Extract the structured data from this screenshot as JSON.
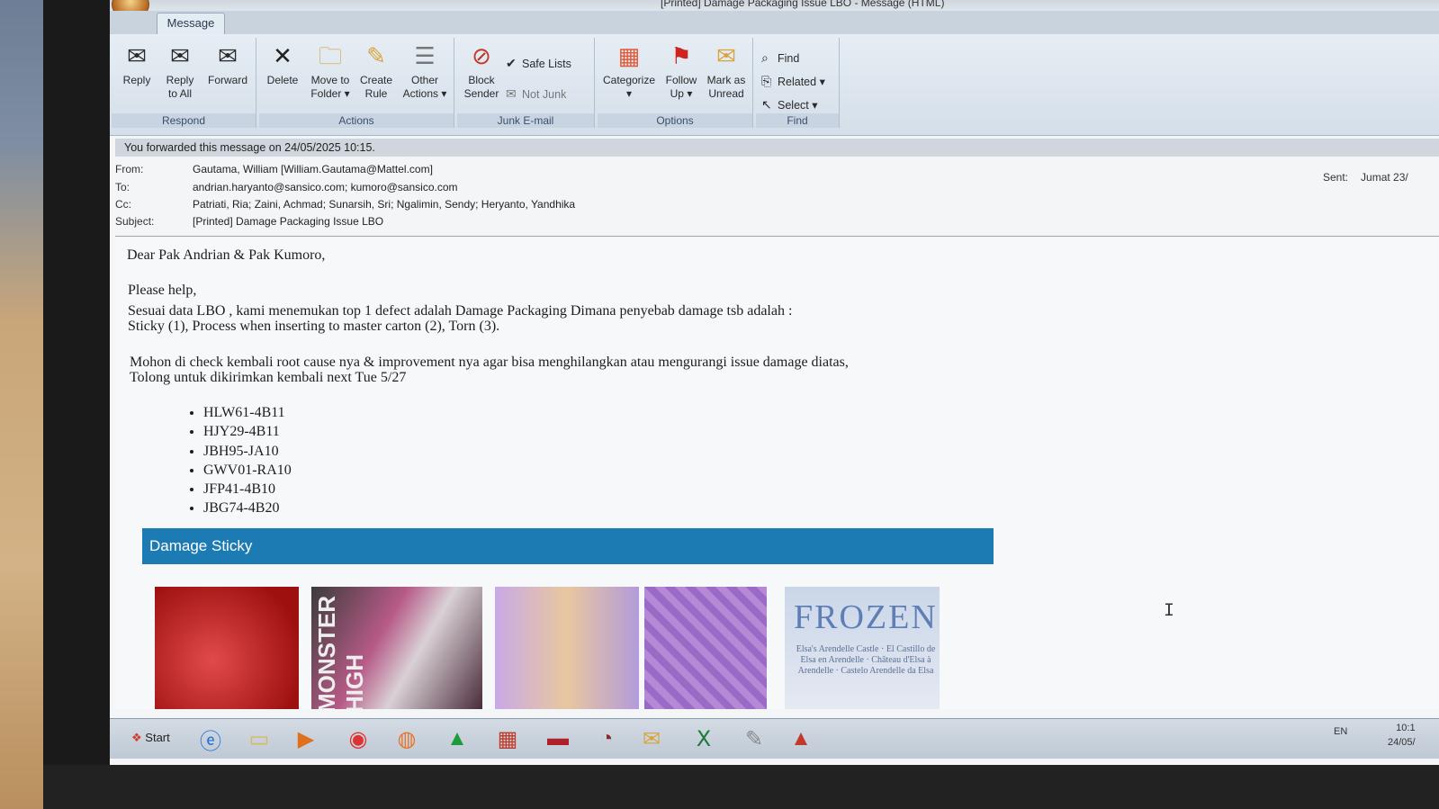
{
  "window": {
    "title": "[Printed] Damage Packaging Issue LBO - Message (HTML)",
    "tab": "Message"
  },
  "ribbon": {
    "respond": {
      "label": "Respond",
      "reply": "Reply",
      "reply_all_1": "Reply",
      "reply_all_2": "to All",
      "forward": "Forward"
    },
    "actions": {
      "label": "Actions",
      "delete": "Delete",
      "move_1": "Move to",
      "move_2": "Folder",
      "create_1": "Create",
      "create_2": "Rule",
      "other_1": "Other",
      "other_2": "Actions"
    },
    "junk": {
      "label": "Junk E-mail",
      "block_1": "Block",
      "block_2": "Sender",
      "safe": "Safe Lists",
      "notjunk": "Not Junk"
    },
    "options": {
      "label": "Options",
      "categorize": "Categorize",
      "follow_1": "Follow",
      "follow_2": "Up",
      "mark_1": "Mark as",
      "mark_2": "Unread"
    },
    "find": {
      "label": "Find",
      "find": "Find",
      "related": "Related",
      "select": "Select"
    }
  },
  "message": {
    "infobar": "You forwarded this message on 24/05/2025 10:15.",
    "from_label": "From:",
    "from": "Gautama, William [William.Gautama@Mattel.com]",
    "to_label": "To:",
    "to": "andrian.haryanto@sansico.com; kumoro@sansico.com",
    "cc_label": "Cc:",
    "cc": "Patriati, Ria; Zaini, Achmad; Sunarsih, Sri; Ngalimin, Sendy; Heryanto, Yandhika",
    "subject_label": "Subject:",
    "subject": "[Printed] Damage Packaging Issue LBO",
    "sent_label": "Sent:",
    "sent": "Jumat 23/"
  },
  "body": {
    "greeting": "Dear Pak Andrian & Pak Kumoro,",
    "line1": "Please help,",
    "line2": "Sesuai data LBO , kami menemukan top 1 defect adalah Damage Packaging Dimana penyebab damage tsb adalah :",
    "line3": "Sticky (1), Process when inserting to master carton (2), Torn (3).",
    "line4": "Mohon di check kembali root cause nya & improvement nya agar bisa menghilangkan atau mengurangi issue damage diatas,",
    "line5": "Tolong untuk dikirimkan kembali next Tue 5/27",
    "codes": [
      "HLW61-4B11",
      "HJY29-4B11",
      "JBH95-JA10",
      "GWV01-RA10",
      "JFP41-4B10",
      "JBG74-4B20"
    ],
    "banner": "Damage Sticky",
    "frozen_logo": "FROZEN",
    "frozen_lines": "Elsa's Arendelle Castle · El Castillo de Elsa en Arendelle · Château d'Elsa à Arendelle · Castelo Arendelle da Elsa",
    "monster": "MONSTER HIGH"
  },
  "taskbar": {
    "start": "Start",
    "lang": "EN",
    "time": "10:1",
    "date": "24/05/"
  }
}
